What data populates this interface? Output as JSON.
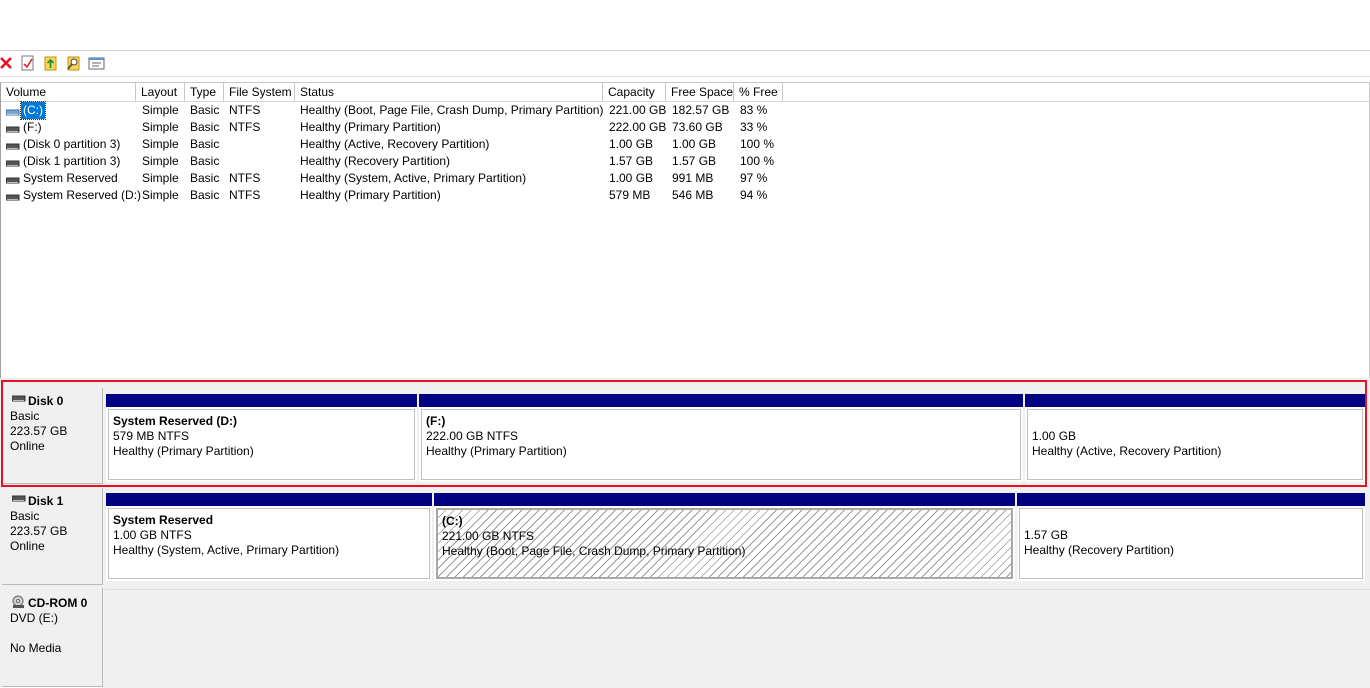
{
  "colors": {
    "partition_bar": "#000080",
    "selection": "#0078d7",
    "highlight": "#e81123"
  },
  "toolbar": {
    "icons": [
      "delete-icon",
      "properties-icon",
      "help-icon",
      "search-icon",
      "settings-icon"
    ]
  },
  "volume_list": {
    "columns": [
      "Volume",
      "Layout",
      "Type",
      "File System",
      "Status",
      "Capacity",
      "Free Space",
      "% Free",
      ""
    ],
    "rows": [
      {
        "volume": "(C:)",
        "layout": "Simple",
        "type": "Basic",
        "fs": "NTFS",
        "status": "Healthy (Boot, Page File, Crash Dump, Primary Partition)",
        "capacity": "221.00 GB",
        "free": "182.57 GB",
        "pct": "83 %",
        "selected": true
      },
      {
        "volume": "(F:)",
        "layout": "Simple",
        "type": "Basic",
        "fs": "NTFS",
        "status": "Healthy (Primary Partition)",
        "capacity": "222.00 GB",
        "free": "73.60 GB",
        "pct": "33 %"
      },
      {
        "volume": "(Disk 0 partition 3)",
        "layout": "Simple",
        "type": "Basic",
        "fs": "",
        "status": "Healthy (Active, Recovery Partition)",
        "capacity": "1.00 GB",
        "free": "1.00 GB",
        "pct": "100 %"
      },
      {
        "volume": "(Disk 1 partition 3)",
        "layout": "Simple",
        "type": "Basic",
        "fs": "",
        "status": "Healthy (Recovery Partition)",
        "capacity": "1.57 GB",
        "free": "1.57 GB",
        "pct": "100 %"
      },
      {
        "volume": "System Reserved",
        "layout": "Simple",
        "type": "Basic",
        "fs": "NTFS",
        "status": "Healthy (System, Active, Primary Partition)",
        "capacity": "1.00 GB",
        "free": "991 MB",
        "pct": "97 %"
      },
      {
        "volume": "System Reserved (D:)",
        "layout": "Simple",
        "type": "Basic",
        "fs": "NTFS",
        "status": "Healthy (Primary Partition)",
        "capacity": "579 MB",
        "free": "546 MB",
        "pct": "94 %"
      }
    ]
  },
  "disks": [
    {
      "name": "Disk 0",
      "type": "Basic",
      "size": "223.57 GB",
      "status": "Online",
      "partitions": [
        {
          "name": "System Reserved  (D:)",
          "size": "579 MB NTFS",
          "status": "Healthy (Primary Partition)"
        },
        {
          "name": "(F:)",
          "size": "222.00 GB NTFS",
          "status": "Healthy (Primary Partition)"
        },
        {
          "name": "",
          "size": "1.00 GB",
          "status": "Healthy (Active, Recovery Partition)"
        }
      ]
    },
    {
      "name": "Disk 1",
      "type": "Basic",
      "size": "223.57 GB",
      "status": "Online",
      "partitions": [
        {
          "name": "System Reserved",
          "size": "1.00 GB NTFS",
          "status": "Healthy (System, Active, Primary Partition)"
        },
        {
          "name": "(C:)",
          "size": "221.00 GB NTFS",
          "status": "Healthy (Boot, Page File, Crash Dump, Primary Partition)",
          "selected": true
        },
        {
          "name": "",
          "size": "1.57 GB",
          "status": "Healthy (Recovery Partition)"
        }
      ]
    },
    {
      "name": "CD-ROM 0",
      "type": "DVD (E:)",
      "media": "No Media"
    }
  ]
}
